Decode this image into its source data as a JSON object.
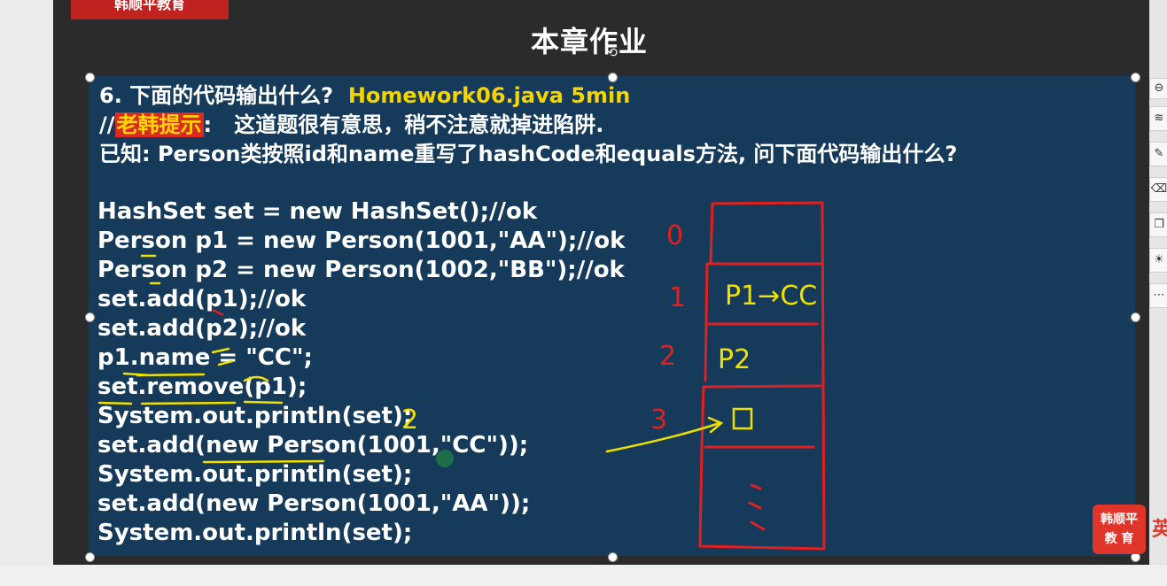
{
  "logo_text": "韩顺平教育",
  "slide_title": "本章作业",
  "question": {
    "prefix": "6. 下面的代码输出什么?",
    "file": "Homework06.java 5min",
    "hint_slashes": "//",
    "hint_label": "老韩提示",
    "hint_colon": ": ",
    "hint_text": "这道题很有意思，稍不注意就掉进陷阱.",
    "known": "已知: Person类按照id和name重写了hashCode和equals方法, 问下面代码输出什么?"
  },
  "code_lines": [
    "HashSet set = new HashSet();//ok",
    "Person p1 = new Person(1001,\"AA\");//ok",
    "Person p2 = new Person(1002,\"BB\");//ok",
    "set.add(p1);//ok",
    "set.add(p2);//ok",
    "p1.name = \"CC\";",
    "set.remove(p1);",
    "System.out.println(set);",
    "set.add(new Person(1001,\"CC\"));",
    "System.out.println(set);",
    "set.add(new Person(1001,\"AA\"));",
    "System.out.println(set);"
  ],
  "annotations": {
    "index_0": "0",
    "index_1": "1",
    "index_2": "2",
    "index_3": "3",
    "bucket1": "P1→CC",
    "bucket2": "P2",
    "output_count": "2"
  },
  "brand_badge": {
    "line1": "韩顺平",
    "line2": "教 育",
    "side_char": "英"
  },
  "toolbar_icons": [
    "minus-icon",
    "layers-icon",
    "pen-icon",
    "eraser-icon",
    "copy-icon",
    "lightbulb-icon",
    "more-icon"
  ],
  "colors": {
    "slide_bg": "#2b2b2b",
    "content_bg": "#163a5a",
    "accent_yellow": "#f5d400",
    "annotation_red": "#e02020",
    "logo_red": "#c0221f"
  }
}
